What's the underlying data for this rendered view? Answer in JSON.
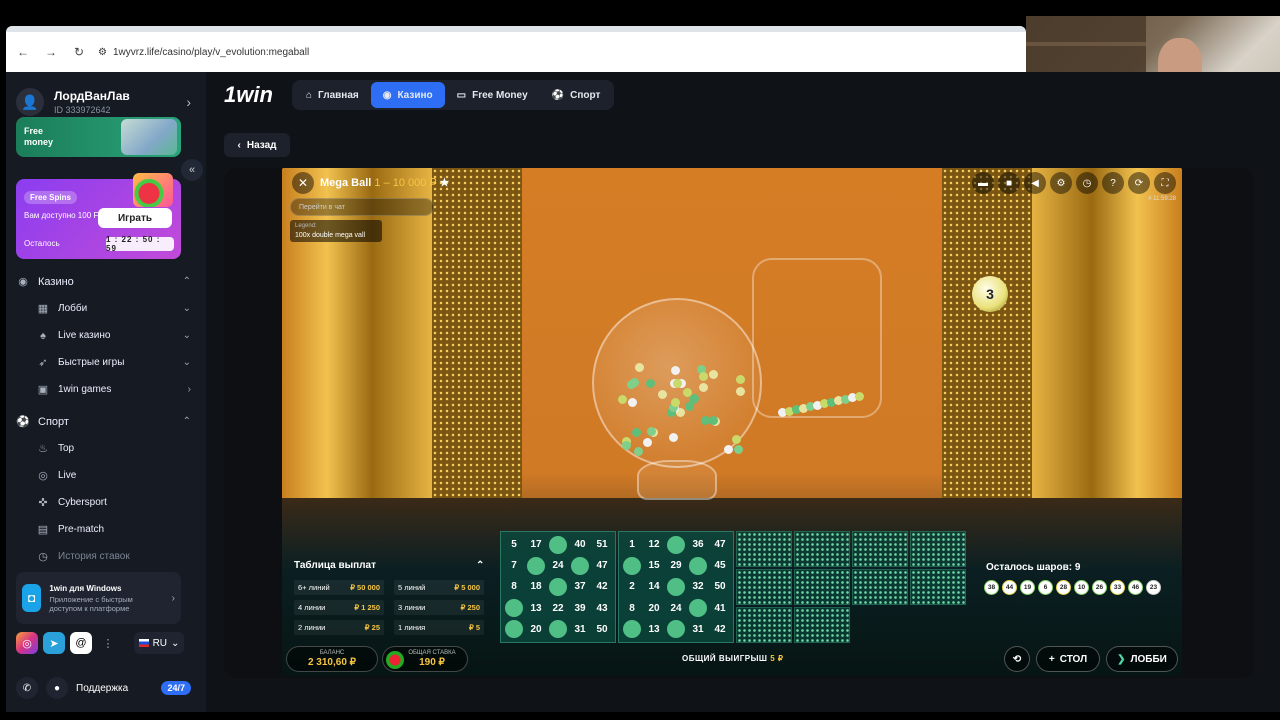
{
  "browser": {
    "url": "1wyvrz.life/casino/play/v_evolution:megaball"
  },
  "sidebar": {
    "profile": {
      "name": "ЛордВанЛав",
      "id": "ID 333972642"
    },
    "free_money_banner": "Free money",
    "free_spins": {
      "badge": "Free Spins",
      "desc": "Вам доступно 100 FS",
      "play": "Играть",
      "left_label": "Осталось",
      "timer": "1 : 22 : 50 : 59"
    },
    "casino_header": "Казино",
    "casino_items": [
      {
        "label": "Лобби"
      },
      {
        "label": "Live казино"
      },
      {
        "label": "Быстрые игры"
      },
      {
        "label": "1win games"
      }
    ],
    "sport_header": "Спорт",
    "sport_items": [
      {
        "label": "Top"
      },
      {
        "label": "Live"
      },
      {
        "label": "Cybersport"
      },
      {
        "label": "Pre-match"
      },
      {
        "label": "История ставок"
      }
    ],
    "windows_app": {
      "title": "1win для Windows",
      "sub": "Приложение с быстрым доступом к платформе"
    },
    "language": "RU",
    "support_label": "Поддержка",
    "support_badge": "24/7"
  },
  "header": {
    "logo": "1win",
    "tabs": [
      {
        "label": "Главная"
      },
      {
        "label": "Казино"
      },
      {
        "label": "Free Money"
      },
      {
        "label": "Спорт"
      }
    ],
    "back": "Назад"
  },
  "game": {
    "title": "Mega Ball",
    "limits": "1 – 10 000 ₽",
    "chat_placeholder": "Перейти в чат",
    "legend_small": "Legend:",
    "legend_text": "100x double mega vall",
    "game_id": "# 11:59:28",
    "drawn_ball": "3",
    "payout_title": "Таблица выплат",
    "payouts": [
      {
        "lines": "6+ линий",
        "value": "₽ 50 000"
      },
      {
        "lines": "5 линий",
        "value": "₽ 5 000"
      },
      {
        "lines": "4 линии",
        "value": "₽ 1 250"
      },
      {
        "lines": "3 линии",
        "value": "₽ 250"
      },
      {
        "lines": "2 линии",
        "value": "₽ 25"
      },
      {
        "lines": "1 линия",
        "value": "₽ 5"
      }
    ],
    "card1": [
      "5",
      "17",
      "",
      "40",
      "51",
      "7",
      "",
      "24",
      "",
      "47",
      "8",
      "18",
      "",
      "37",
      "42",
      "",
      "13",
      "22",
      "39",
      "43",
      "",
      "20",
      "",
      "31",
      "50"
    ],
    "card1_hits": [
      2,
      6,
      8,
      12,
      15,
      20,
      22
    ],
    "card2": [
      "1",
      "12",
      "",
      "36",
      "47",
      "",
      "15",
      "29",
      "",
      "45",
      "2",
      "14",
      "",
      "32",
      "50",
      "8",
      "20",
      "24",
      "",
      "41",
      "",
      "13",
      "",
      "31",
      "42"
    ],
    "card2_hits": [
      2,
      5,
      8,
      12,
      18,
      20,
      22
    ],
    "balls_left_label": "Осталось шаров: 9",
    "drawn_balls": [
      "38",
      "44",
      "19",
      "6",
      "28",
      "10",
      "26",
      "33",
      "46",
      "23"
    ],
    "balance_label": "БАЛАНС",
    "balance_value": "2 310,60 ₽",
    "total_bet_label": "ОБЩАЯ СТАВКА",
    "total_bet_value": "190 ₽",
    "total_win_label": "ОБЩИЙ ВЫИГРЫШ",
    "total_win_value": "5 ₽",
    "table_button": "СТОЛ",
    "lobby_button": "ЛОББИ"
  }
}
